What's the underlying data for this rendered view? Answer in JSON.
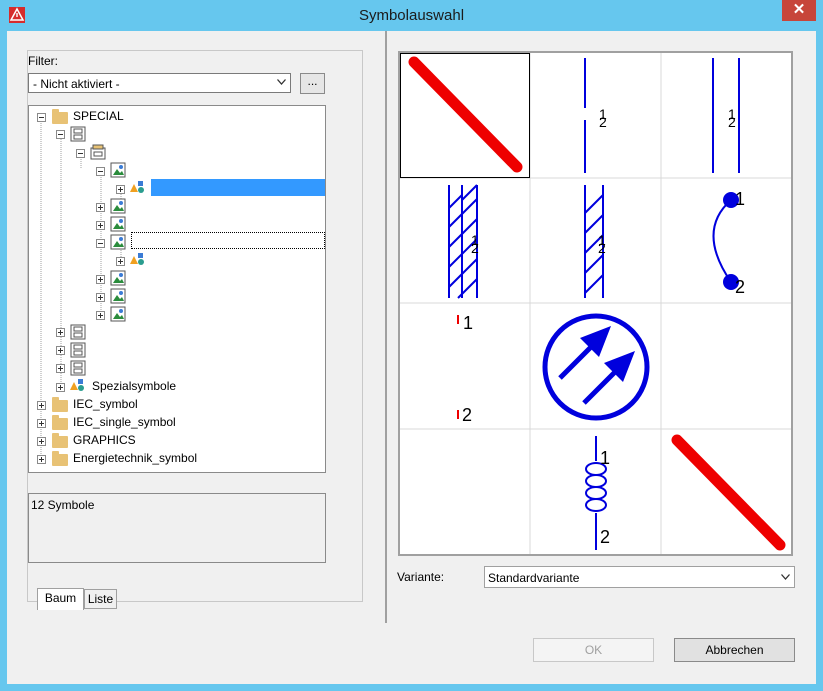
{
  "window": {
    "title": "Symbolauswahl",
    "close_glyph": "✕"
  },
  "filter": {
    "label": "Filter:",
    "value": "- Nicht aktiviert -",
    "browse_label": "..."
  },
  "tree": {
    "special": "SPECIAL",
    "spezialsymbole": "Spezialsymbole",
    "iec_symbol": "IEC_symbol",
    "iec_single_symbol": "IEC_single_symbol",
    "graphics": "GRAPHICS",
    "energietechnik": "Energietechnik_symbol"
  },
  "status": {
    "count_text": "12 Symbole"
  },
  "tabs": {
    "baum": "Baum",
    "liste": "Liste"
  },
  "grid": {
    "label_1": "1",
    "label_2": "2",
    "cell_count": 12
  },
  "variante": {
    "label": "Variante:",
    "value": "Standardvariante"
  },
  "buttons": {
    "ok": "OK",
    "cancel": "Abbrechen"
  },
  "colors": {
    "titlebar": "#66c7ee",
    "selection": "#3399ff",
    "symbol_blue": "#0000dd",
    "symbol_red": "#ee0000",
    "close": "#c7453a"
  }
}
